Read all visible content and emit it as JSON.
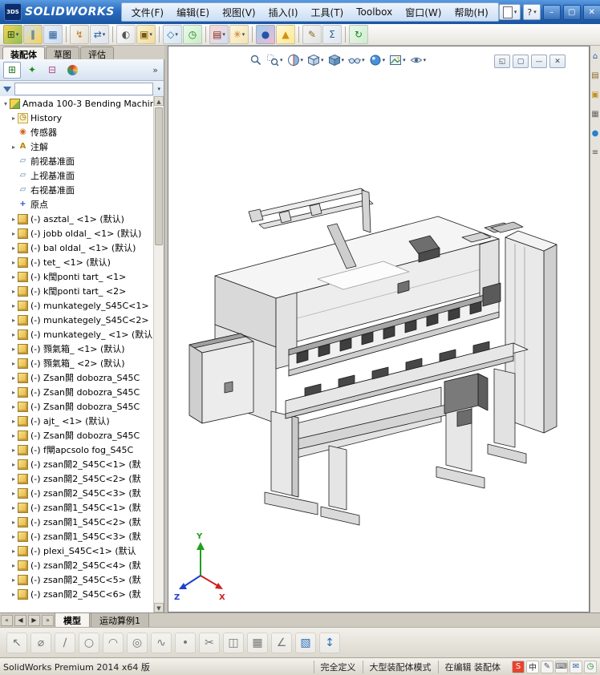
{
  "titlebar": {
    "logo_badge": "3DS",
    "logo_text": "SOLIDWORKS",
    "menus": [
      "文件(F)",
      "编辑(E)",
      "视图(V)",
      "插入(I)",
      "工具(T)",
      "Toolbox",
      "窗口(W)",
      "帮助(H)"
    ],
    "quick_access": [
      {
        "name": "new-document-button",
        "glyph": "",
        "caret": true
      },
      {
        "name": "help-button",
        "glyph": "?",
        "caret": true
      }
    ],
    "window_controls": [
      {
        "name": "minimize-button",
        "glyph": "–"
      },
      {
        "name": "maximize-button",
        "glyph": "▢"
      },
      {
        "name": "close-button",
        "glyph": "✕"
      }
    ]
  },
  "toolbar": {
    "icons": [
      {
        "name": "insert-component-button",
        "glyph": "⊞",
        "c1": "#f7d354",
        "c2": "#8ec05a",
        "fg": "#234f12",
        "caret": true
      },
      {
        "name": "mate-button",
        "glyph": "∥",
        "c1": "#cfe0f5",
        "c2": "#f7d354",
        "fg": "#1a4f8a"
      },
      {
        "name": "linear-component-pattern-button",
        "glyph": "▦",
        "c1": "#e8eef6",
        "c2": "#cddcf0",
        "fg": "#2a6099"
      },
      {
        "sep": true
      },
      {
        "name": "smart-fasteners-button",
        "glyph": "↯",
        "c1": "#f6f4ee",
        "c2": "#e6e0d2",
        "fg": "#b87a1e"
      },
      {
        "name": "move-component-button",
        "glyph": "⇄",
        "c1": "#f2f2f2",
        "c2": "#dde5ee",
        "fg": "#2a6099",
        "caret": true
      },
      {
        "sep": true
      },
      {
        "name": "show-hidden-components-button",
        "glyph": "◐",
        "c1": "#fdfdfd",
        "c2": "#e6e6e6",
        "fg": "#555555"
      },
      {
        "name": "assembly-features-button",
        "glyph": "▣",
        "c1": "#fbf3d0",
        "c2": "#f0dc9a",
        "fg": "#7a5a10",
        "caret": true
      },
      {
        "sep": true
      },
      {
        "name": "reference-geometry-button",
        "glyph": "◇",
        "c1": "#eef4fa",
        "c2": "#d8e6f4",
        "fg": "#1f6f9f",
        "caret": true
      },
      {
        "name": "new-motion-study-button",
        "glyph": "◷",
        "c1": "#eafbea",
        "c2": "#c8ecc8",
        "fg": "#1d7a1d"
      },
      {
        "sep": true
      },
      {
        "name": "bill-of-materials-button",
        "glyph": "▤",
        "c1": "#f6d8d2",
        "c2": "#d2def6",
        "fg": "#8a2a1a",
        "caret": true
      },
      {
        "name": "exploded-view-button",
        "glyph": "✳",
        "c1": "#fdf6e0",
        "c2": "#f4e4b0",
        "fg": "#c07818",
        "caret": true
      },
      {
        "sep": true
      },
      {
        "name": "edit-appearance-button",
        "glyph": "●",
        "c1": "#9ad0f0",
        "c2": "#f2b8d0",
        "fg": "#2255aa"
      },
      {
        "name": "interference-detection-button",
        "glyph": "▲",
        "c1": "#fff8d8",
        "c2": "#ffe890",
        "fg": "#d09010"
      },
      {
        "sep": true
      },
      {
        "name": "measure-button",
        "glyph": "✎",
        "c1": "#f4f4f4",
        "c2": "#e2e2e2",
        "fg": "#8a6a1a"
      },
      {
        "name": "mass-properties-button",
        "glyph": "Σ",
        "c1": "#f0f4f8",
        "c2": "#dfe6ee",
        "fg": "#2a6099"
      },
      {
        "sep": true
      },
      {
        "name": "rebuild-button",
        "glyph": "↻",
        "c1": "#eaf8ea",
        "c2": "#cfeccf",
        "fg": "#1d8a1d"
      }
    ]
  },
  "command_manager": {
    "tabs": [
      {
        "label": "装配体",
        "active": true
      },
      {
        "label": "草图",
        "active": false
      },
      {
        "label": "评估",
        "active": false
      }
    ]
  },
  "feature_panel": {
    "header_icons": [
      {
        "name": "featuremanager-tab-icon",
        "glyph": "⊞",
        "fg": "#2a7a2a",
        "active": true
      },
      {
        "name": "propertymanager-tab-icon",
        "glyph": "✦",
        "fg": "#1d8a1d",
        "active": false
      },
      {
        "name": "configurationmanager-tab-icon",
        "glyph": "⊟",
        "fg": "#b05090",
        "active": false
      },
      {
        "name": "displaymanager-tab-icon",
        "glyph": "",
        "ball": true,
        "active": false
      }
    ],
    "chevron": "»",
    "tree": [
      {
        "t": "assembly",
        "exp": "open",
        "root": true,
        "label": "Amada 100-3 Bending Machin"
      },
      {
        "t": "history",
        "exp": "closed",
        "label": "History"
      },
      {
        "t": "sensors",
        "label": "传感器"
      },
      {
        "t": "annotations",
        "exp": "closed",
        "label": "注解"
      },
      {
        "t": "plane",
        "label": "前视基准面"
      },
      {
        "t": "plane",
        "label": "上视基准面"
      },
      {
        "t": "plane",
        "label": "右视基准面"
      },
      {
        "t": "origin",
        "label": "原点"
      },
      {
        "t": "part",
        "exp": "closed",
        "label": "(-) asztal_ <1> (默认)"
      },
      {
        "t": "part",
        "exp": "closed",
        "label": "(-) jobb oldal_ <1> (默认)"
      },
      {
        "t": "part",
        "exp": "closed",
        "label": "(-) bal oldal_ <1> (默认)"
      },
      {
        "t": "part",
        "exp": "closed",
        "label": "(-) tet_ <1> (默认)"
      },
      {
        "t": "part",
        "exp": "closed",
        "label": "(-) k閠ponti tart_ <1>"
      },
      {
        "t": "part",
        "exp": "closed",
        "label": "(-) k閠ponti tart_ <2>"
      },
      {
        "t": "part",
        "exp": "closed",
        "label": "(-) munkategely_S45C<1>"
      },
      {
        "t": "part",
        "exp": "closed",
        "label": "(-) munkategely_S45C<2>"
      },
      {
        "t": "part",
        "exp": "closed",
        "label": "(-) munkategely_ <1> (默认)"
      },
      {
        "t": "part",
        "exp": "closed",
        "label": "(-) 顟氣箱_ <1> (默认)"
      },
      {
        "t": "part",
        "exp": "closed",
        "label": "(-) 顟氣箱_ <2> (默认)"
      },
      {
        "t": "part",
        "exp": "closed",
        "label": "(-) Zsan閞 dobozra_S45C"
      },
      {
        "t": "part",
        "exp": "closed",
        "label": "(-) Zsan閞 dobozra_S45C"
      },
      {
        "t": "part",
        "exp": "closed",
        "label": "(-) Zsan閞 dobozra_S45C"
      },
      {
        "t": "part",
        "exp": "closed",
        "label": "(-) ajt_ <1> (默认)"
      },
      {
        "t": "part",
        "exp": "closed",
        "label": "(-) Zsan閞 dobozra_S45C"
      },
      {
        "t": "part",
        "exp": "closed",
        "label": "(-) f閘apcsolo fog_S45C"
      },
      {
        "t": "part",
        "exp": "closed",
        "label": "(-) zsan閞2_S45C<1> (默"
      },
      {
        "t": "part",
        "exp": "closed",
        "label": "(-) zsan閞2_S45C<2> (默"
      },
      {
        "t": "part",
        "exp": "closed",
        "label": "(-) zsan閞2_S45C<3> (默"
      },
      {
        "t": "part",
        "exp": "closed",
        "label": "(-) zsan閞1_S45C<1> (默"
      },
      {
        "t": "part",
        "exp": "closed",
        "label": "(-) zsan閞1_S45C<2> (默"
      },
      {
        "t": "part",
        "exp": "closed",
        "label": "(-) zsan閞1_S45C<3> (默"
      },
      {
        "t": "part",
        "exp": "closed",
        "label": "(-) plexi_S45C<1> (默认"
      },
      {
        "t": "part",
        "exp": "closed",
        "label": "(-) zsan閞2_S45C<4> (默"
      },
      {
        "t": "part",
        "exp": "closed",
        "label": "(-) zsan閞2_S45C<5> (默"
      },
      {
        "t": "part",
        "exp": "closed",
        "label": "(-) zsan閞2_S45C<6> (默"
      }
    ]
  },
  "viewport": {
    "headsup": [
      {
        "name": "zoom-fit-icon"
      },
      {
        "name": "zoom-area-icon",
        "caret": true
      },
      {
        "name": "section-view-icon",
        "caret": true
      },
      {
        "name": "view-orientation-icon",
        "caret": true
      },
      {
        "name": "display-style-icon",
        "caret": true
      },
      {
        "name": "hide-show-items-icon",
        "caret": true
      },
      {
        "name": "edit-appearance-icon",
        "caret": true
      },
      {
        "name": "apply-scene-icon",
        "caret": true
      },
      {
        "name": "view-settings-icon",
        "caret": true
      }
    ],
    "doc_controls": [
      {
        "name": "doc-restore-icon",
        "glyph": "◱"
      },
      {
        "name": "doc-tile-icon",
        "glyph": "▢"
      },
      {
        "name": "doc-minimize-icon",
        "glyph": "—"
      },
      {
        "name": "doc-close-icon",
        "glyph": "✕"
      }
    ],
    "triad": {
      "x": "X",
      "y": "Y",
      "z": "Z"
    }
  },
  "task_pane": {
    "icons": [
      {
        "name": "resources-home-icon",
        "glyph": "⌂",
        "fg": "#2a5fa8"
      },
      {
        "name": "design-library-icon",
        "glyph": "▤",
        "fg": "#8a6a2a"
      },
      {
        "name": "file-explorer-icon",
        "glyph": "▣",
        "fg": "#c09020"
      },
      {
        "name": "view-palette-icon",
        "glyph": "▦",
        "fg": "#666666"
      },
      {
        "name": "appearances-icon",
        "glyph": "●",
        "fg": "#2a7fd0"
      },
      {
        "name": "custom-properties-icon",
        "glyph": "≡",
        "fg": "#555555"
      }
    ]
  },
  "bottom_bar": {
    "nav": [
      "«",
      "◀",
      "▶",
      "»"
    ],
    "tabs": [
      {
        "label": "模型",
        "active": true
      },
      {
        "label": "运动算例1",
        "active": false
      }
    ]
  },
  "sketch_toolbar": {
    "icons": [
      {
        "name": "select-tool-icon",
        "glyph": "↖"
      },
      {
        "name": "smart-dimension-icon",
        "glyph": "⌀"
      },
      {
        "name": "line-tool-icon",
        "glyph": "∕"
      },
      {
        "name": "circle-tool-icon",
        "glyph": "○"
      },
      {
        "name": "arc-tool-icon",
        "glyph": "◠"
      },
      {
        "name": "ellipse-tool-icon",
        "glyph": "◎"
      },
      {
        "name": "spline-tool-icon",
        "glyph": "∿"
      },
      {
        "name": "point-tool-icon",
        "glyph": "•"
      },
      {
        "name": "trim-entities-icon",
        "glyph": "✂"
      },
      {
        "name": "mirror-entities-icon",
        "glyph": "◫"
      },
      {
        "name": "linear-sketch-pattern-icon",
        "glyph": "▦"
      },
      {
        "name": "angle-dimension-icon",
        "glyph": "∠"
      },
      {
        "name": "instant3d-icon",
        "glyph": "▧",
        "fg": "#2a6fc0"
      },
      {
        "name": "move-entities-icon",
        "glyph": "↕",
        "fg": "#2a6fc0"
      }
    ]
  },
  "statusbar": {
    "left_text": "SolidWorks Premium 2014 x64 版",
    "badges": [
      "完全定义",
      "大型装配体模式",
      "在编辑 装配体"
    ],
    "tray": [
      {
        "name": "ime-sogou-icon",
        "glyph": "S",
        "bg": "#e8432e",
        "fg": "#ffffff"
      },
      {
        "name": "ime-lang-chinese-icon",
        "glyph": "中",
        "bg": "#ffffff",
        "fg": "#222222"
      },
      {
        "name": "ime-pen-icon",
        "glyph": "✎",
        "bg": "#f4f4f4",
        "fg": "#555555"
      },
      {
        "name": "ime-keyboard-icon",
        "glyph": "⌨",
        "bg": "#f4f4f4",
        "fg": "#555555"
      },
      {
        "name": "tray-message-icon",
        "glyph": "✉",
        "bg": "#f4f4f4",
        "fg": "#2a6099"
      },
      {
        "name": "tray-clock-icon",
        "glyph": "◷",
        "bg": "#f4f4f4",
        "fg": "#1d7a1d"
      }
    ]
  }
}
